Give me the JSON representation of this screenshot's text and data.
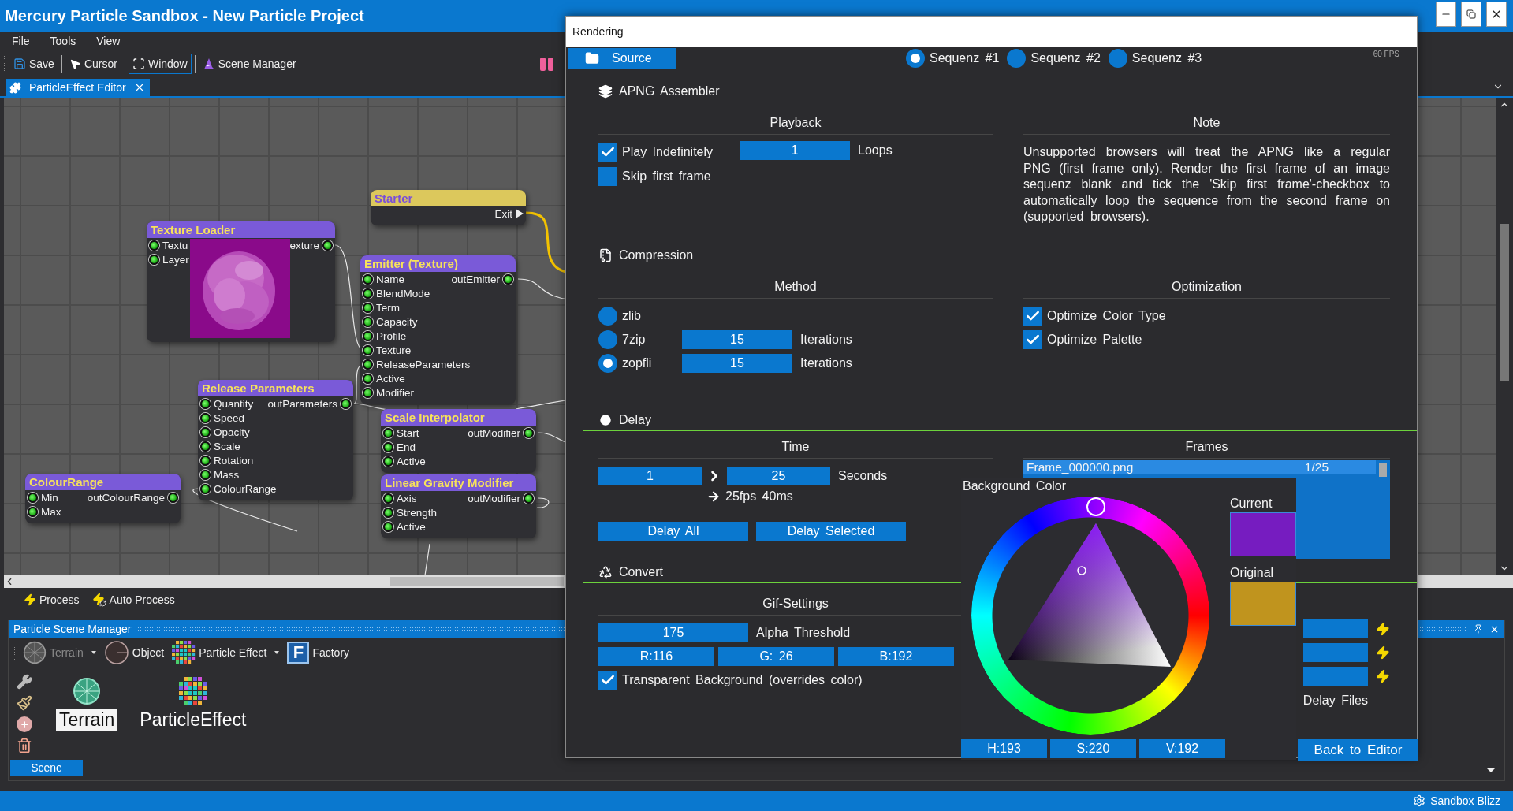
{
  "window": {
    "title": "Mercury Particle Sandbox - New Particle Project"
  },
  "menu": [
    "File",
    "Tools",
    "View"
  ],
  "toolbar": [
    {
      "label": "Save",
      "kind": "save",
      "selected": false
    },
    {
      "label": "Cursor",
      "kind": "cursor",
      "selected": false
    },
    {
      "label": "Window",
      "kind": "window",
      "selected": true
    },
    {
      "label": "Scene Manager",
      "kind": "wizard",
      "selected": false
    }
  ],
  "document_tabs": [
    {
      "label": "ParticleEffect Editor",
      "selected": true
    }
  ],
  "nodes": [
    {
      "title": "Starter",
      "kind": "starter",
      "rows": [
        {
          "out": "Exit"
        }
      ]
    },
    {
      "title": "Texture Loader",
      "kind": "texture",
      "rows": [
        {
          "in": "Textu",
          "out": "exture"
        },
        {
          "in": "Layer"
        }
      ]
    },
    {
      "title": "Emitter (Texture)",
      "kind": "module",
      "rows": [
        {
          "in": "Name",
          "out": "outEmitter"
        },
        {
          "in": "BlendMode"
        },
        {
          "in": "Term"
        },
        {
          "in": "Capacity"
        },
        {
          "in": "Profile"
        },
        {
          "in": "Texture"
        },
        {
          "in": "ReleaseParameters"
        },
        {
          "in": "Active"
        },
        {
          "in": "Modifier"
        }
      ]
    },
    {
      "title": "Release Parameters",
      "kind": "module",
      "rows": [
        {
          "in": "Quantity",
          "out": "outParameters"
        },
        {
          "in": "Speed"
        },
        {
          "in": "Opacity"
        },
        {
          "in": "Scale"
        },
        {
          "in": "Rotation"
        },
        {
          "in": "Mass"
        },
        {
          "in": "ColourRange"
        }
      ]
    },
    {
      "title": "Scale Interpolator",
      "kind": "module",
      "rows": [
        {
          "in": "Start",
          "out": "outModifier"
        },
        {
          "in": "End"
        },
        {
          "in": "Active"
        }
      ]
    },
    {
      "title": "ColourRange",
      "kind": "module",
      "rows": [
        {
          "in": "Min",
          "out": "outColourRange"
        },
        {
          "in": "Max"
        }
      ]
    },
    {
      "title": "Linear Gravity Modifier",
      "kind": "module",
      "rows": [
        {
          "in": "Axis",
          "out": "outModifier"
        },
        {
          "in": "Strength"
        },
        {
          "in": "Active"
        }
      ]
    }
  ],
  "process_bar": [
    {
      "label": "Process",
      "kind": "process"
    },
    {
      "label": "Auto Process",
      "kind": "auto"
    }
  ],
  "scene_manager": {
    "title": "Particle Scene Manager",
    "tools": [
      {
        "label": "Terrain",
        "kind": "terrain",
        "disabled": true,
        "dropdown": true
      },
      {
        "label": "Object",
        "kind": "object",
        "disabled": false,
        "dropdown": false
      },
      {
        "label": "Particle Effect",
        "kind": "particles",
        "disabled": false,
        "dropdown": true
      },
      {
        "label": "Factory",
        "kind": "factory",
        "disabled": false,
        "dropdown": false,
        "letter": "F"
      }
    ],
    "items": [
      {
        "label": "Terrain",
        "kind": "terrain",
        "selected": true
      },
      {
        "label": "ParticleEffect",
        "kind": "particles",
        "selected": false
      }
    ],
    "tabs": [
      {
        "label": "Scene",
        "selected": true
      }
    ]
  },
  "status_bar": {
    "text": "Sandbox Blizz"
  },
  "rendering": {
    "title": "Rendering",
    "source": "Source",
    "fps": "60 FPS",
    "sequences": [
      {
        "label": "Sequenz #1",
        "selected": true
      },
      {
        "label": "Sequenz #2",
        "selected": false
      },
      {
        "label": "Sequenz #3",
        "selected": false
      }
    ],
    "apng": {
      "title": "APNG Assembler",
      "playback": {
        "title": "Playback",
        "options": [
          {
            "label": "Play Indefinitely",
            "checked": true
          },
          {
            "label": "Skip first frame",
            "checked": false
          }
        ],
        "loops": "1",
        "loops_label": "Loops"
      },
      "note": {
        "title": "Note",
        "text": "Unsupported browsers will treat the APNG like a regular PNG (first frame only). Render the first frame of an image sequenz blank and tick the 'Skip first frame'-checkbox to automatically loop the sequence from the second frame on (supported browsers)."
      }
    },
    "compression": {
      "title": "Compression",
      "method": {
        "title": "Method",
        "options": [
          {
            "label": "zlib",
            "selected": false
          },
          {
            "label": "7zip",
            "selected": false,
            "iterations": "15",
            "iterations_label": "Iterations"
          },
          {
            "label": "zopfli",
            "selected": true,
            "iterations": "15",
            "iterations_label": "Iterations"
          }
        ]
      },
      "optimization": {
        "title": "Optimization",
        "options": [
          {
            "label": "Optimize Color Type",
            "checked": true
          },
          {
            "label": "Optimize Palette",
            "checked": true
          }
        ]
      }
    },
    "delay": {
      "title": "Delay",
      "time": {
        "title": "Time",
        "from": "1",
        "to": "25",
        "unit": "Seconds",
        "fps": "25fps 40ms",
        "buttons": [
          "Delay All",
          "Delay Selected"
        ]
      },
      "frames": {
        "title": "Frames",
        "rows": [
          {
            "name": "Frame_000000.png",
            "count": "1/25",
            "selected": true
          }
        ]
      }
    },
    "convert": {
      "title": "Convert",
      "gif": {
        "title": "Gif-Settings",
        "alpha": "175",
        "alpha_label": "Alpha Threshold",
        "rgb": [
          "R:116",
          "G: 26",
          "B:192"
        ],
        "options": [
          {
            "label": "Transparent Background (overrides color)",
            "checked": true
          }
        ]
      },
      "delay_files": "Delay Files",
      "back": "Back to Editor"
    },
    "color_picker": {
      "title": "Background Color",
      "current_label": "Current",
      "original_label": "Original",
      "hsv": [
        "H:193",
        "S:220",
        "V:192"
      ]
    }
  }
}
